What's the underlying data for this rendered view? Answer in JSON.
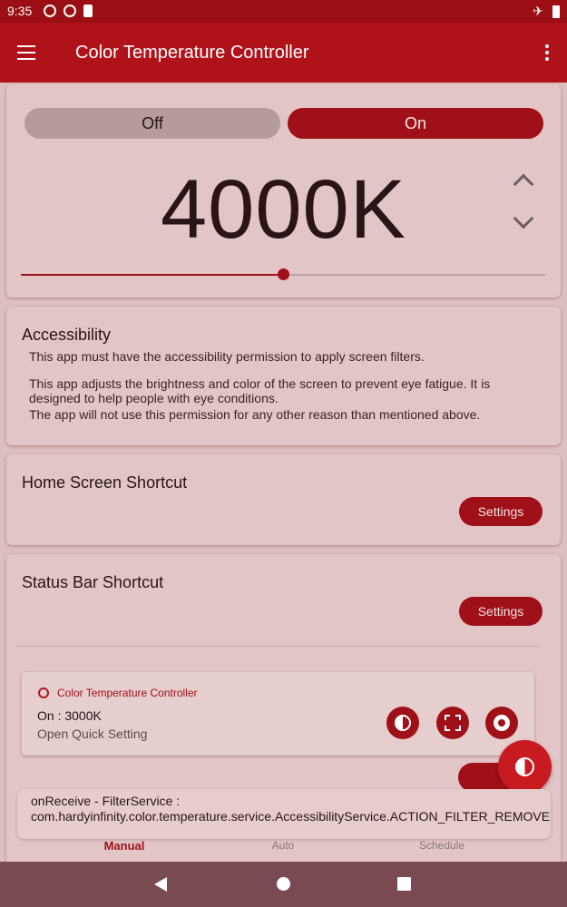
{
  "status_bar": {
    "time": "9:35",
    "icons": [
      "contrast-icon",
      "app-icon",
      "sd-card-icon",
      "airplane-icon",
      "battery-icon"
    ]
  },
  "app_bar": {
    "title": "Color Temperature Controller"
  },
  "temperature_card": {
    "off_label": "Off",
    "on_label": "On",
    "value": "4000K",
    "slider_fraction": 0.5
  },
  "accessibility": {
    "title": "Accessibility",
    "line1": "This app must have the accessibility permission to apply screen filters.",
    "line2": "This app adjusts the brightness and color of the screen to prevent eye fatigue. It is designed to help people with eye conditions.",
    "line3": "The app will not use this permission for any other reason than mentioned above."
  },
  "home_shortcut": {
    "title": "Home Screen Shortcut",
    "button": "Settings"
  },
  "status_shortcut": {
    "title": "Status Bar Shortcut",
    "button": "Settings"
  },
  "notification_preview": {
    "app_name": "Color Temperature Controller",
    "status": "On : 3000K",
    "subtitle": "Open Quick Setting"
  },
  "toast": {
    "message": "onReceive - FilterService : com.hardyinfinity.color.temperature.service.AccessibilityService.ACTION_FILTER_REMOVE"
  },
  "bottom_nav": {
    "items": [
      {
        "label": "Manual"
      },
      {
        "label": "Auto"
      },
      {
        "label": "Schedule"
      }
    ]
  },
  "colors": {
    "accent": "#9f1018",
    "app_bar": "#b01219",
    "background": "#dcbfc0"
  }
}
